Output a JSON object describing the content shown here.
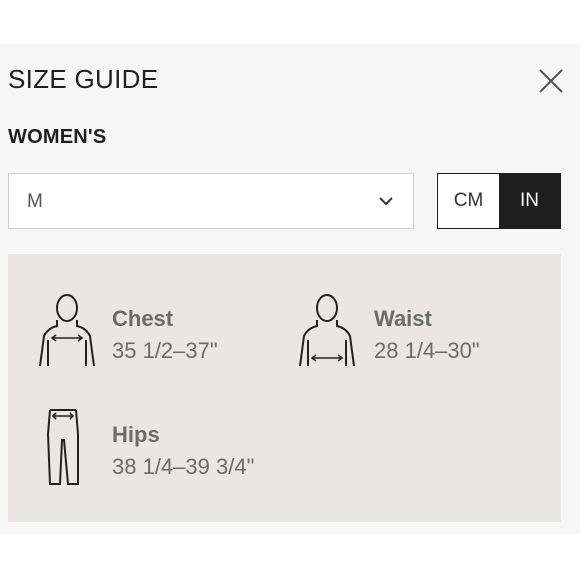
{
  "header": {
    "title": "SIZE GUIDE",
    "close_icon": "close-icon"
  },
  "category": "WOMEN'S",
  "size_select": {
    "selected": "M",
    "icon": "chevron-down-icon"
  },
  "units": {
    "options": [
      "CM",
      "IN"
    ],
    "selected": "IN"
  },
  "measurements": [
    {
      "label": "Chest",
      "value": "35 1/2–37\"",
      "icon": "chest-figure-icon"
    },
    {
      "label": "Waist",
      "value": "28 1/4–30\"",
      "icon": "waist-figure-icon"
    },
    {
      "label": "Hips",
      "value": "38 1/4–39 3/4\"",
      "icon": "hips-figure-icon"
    }
  ],
  "colors": {
    "panel_bg": "#f7f6f6",
    "measure_bg": "#e9e6e5",
    "active_unit": "#1e1e1e"
  }
}
